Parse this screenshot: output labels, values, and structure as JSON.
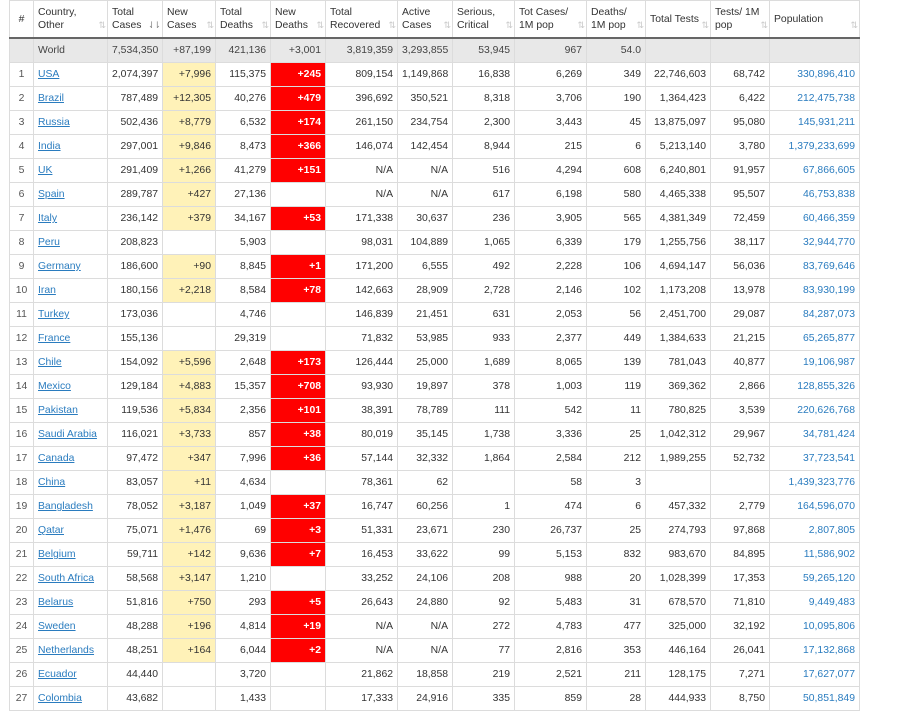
{
  "headers": [
    {
      "key": "idx",
      "label": "#",
      "sort": ""
    },
    {
      "key": "country",
      "label": "Country, Other",
      "sort": "⇅"
    },
    {
      "key": "total_cases",
      "label": "Total Cases",
      "sort": "⇃⇂",
      "active": true
    },
    {
      "key": "new_cases",
      "label": "New Cases",
      "sort": "⇅"
    },
    {
      "key": "total_deaths",
      "label": "Total Deaths",
      "sort": "⇅"
    },
    {
      "key": "new_deaths",
      "label": "New Deaths",
      "sort": "⇅"
    },
    {
      "key": "total_recovered",
      "label": "Total Recovered",
      "sort": "⇅"
    },
    {
      "key": "active_cases",
      "label": "Active Cases",
      "sort": "⇅"
    },
    {
      "key": "serious",
      "label": "Serious, Critical",
      "sort": "⇅"
    },
    {
      "key": "cases_per_m",
      "label": "Tot Cases/ 1M pop",
      "sort": "⇅"
    },
    {
      "key": "deaths_per_m",
      "label": "Deaths/ 1M pop",
      "sort": "⇅"
    },
    {
      "key": "total_tests",
      "label": "Total Tests",
      "sort": "⇅"
    },
    {
      "key": "tests_per_m",
      "label": "Tests/ 1M pop",
      "sort": "⇅"
    },
    {
      "key": "population",
      "label": "Population",
      "sort": "⇅"
    }
  ],
  "world": [
    "",
    "World",
    "7,534,350",
    "+87,199",
    "421,136",
    "+3,001",
    "3,819,359",
    "3,293,855",
    "53,945",
    "967",
    "54.0",
    "",
    "",
    ""
  ],
  "rows": [
    [
      "1",
      "USA",
      "2,074,397",
      "+7,996",
      "115,375",
      "+245",
      "809,154",
      "1,149,868",
      "16,838",
      "6,269",
      "349",
      "22,746,603",
      "68,742",
      "330,896,410"
    ],
    [
      "2",
      "Brazil",
      "787,489",
      "+12,305",
      "40,276",
      "+479",
      "396,692",
      "350,521",
      "8,318",
      "3,706",
      "190",
      "1,364,423",
      "6,422",
      "212,475,738"
    ],
    [
      "3",
      "Russia",
      "502,436",
      "+8,779",
      "6,532",
      "+174",
      "261,150",
      "234,754",
      "2,300",
      "3,443",
      "45",
      "13,875,097",
      "95,080",
      "145,931,211"
    ],
    [
      "4",
      "India",
      "297,001",
      "+9,846",
      "8,473",
      "+366",
      "146,074",
      "142,454",
      "8,944",
      "215",
      "6",
      "5,213,140",
      "3,780",
      "1,379,233,699"
    ],
    [
      "5",
      "UK",
      "291,409",
      "+1,266",
      "41,279",
      "+151",
      "N/A",
      "N/A",
      "516",
      "4,294",
      "608",
      "6,240,801",
      "91,957",
      "67,866,605"
    ],
    [
      "6",
      "Spain",
      "289,787",
      "+427",
      "27,136",
      "",
      "N/A",
      "N/A",
      "617",
      "6,198",
      "580",
      "4,465,338",
      "95,507",
      "46,753,838"
    ],
    [
      "7",
      "Italy",
      "236,142",
      "+379",
      "34,167",
      "+53",
      "171,338",
      "30,637",
      "236",
      "3,905",
      "565",
      "4,381,349",
      "72,459",
      "60,466,359"
    ],
    [
      "8",
      "Peru",
      "208,823",
      "",
      "5,903",
      "",
      "98,031",
      "104,889",
      "1,065",
      "6,339",
      "179",
      "1,255,756",
      "38,117",
      "32,944,770"
    ],
    [
      "9",
      "Germany",
      "186,600",
      "+90",
      "8,845",
      "+1",
      "171,200",
      "6,555",
      "492",
      "2,228",
      "106",
      "4,694,147",
      "56,036",
      "83,769,646"
    ],
    [
      "10",
      "Iran",
      "180,156",
      "+2,218",
      "8,584",
      "+78",
      "142,663",
      "28,909",
      "2,728",
      "2,146",
      "102",
      "1,173,208",
      "13,978",
      "83,930,199"
    ],
    [
      "11",
      "Turkey",
      "173,036",
      "",
      "4,746",
      "",
      "146,839",
      "21,451",
      "631",
      "2,053",
      "56",
      "2,451,700",
      "29,087",
      "84,287,073"
    ],
    [
      "12",
      "France",
      "155,136",
      "",
      "29,319",
      "",
      "71,832",
      "53,985",
      "933",
      "2,377",
      "449",
      "1,384,633",
      "21,215",
      "65,265,877"
    ],
    [
      "13",
      "Chile",
      "154,092",
      "+5,596",
      "2,648",
      "+173",
      "126,444",
      "25,000",
      "1,689",
      "8,065",
      "139",
      "781,043",
      "40,877",
      "19,106,987"
    ],
    [
      "14",
      "Mexico",
      "129,184",
      "+4,883",
      "15,357",
      "+708",
      "93,930",
      "19,897",
      "378",
      "1,003",
      "119",
      "369,362",
      "2,866",
      "128,855,326"
    ],
    [
      "15",
      "Pakistan",
      "119,536",
      "+5,834",
      "2,356",
      "+101",
      "38,391",
      "78,789",
      "111",
      "542",
      "11",
      "780,825",
      "3,539",
      "220,626,768"
    ],
    [
      "16",
      "Saudi Arabia",
      "116,021",
      "+3,733",
      "857",
      "+38",
      "80,019",
      "35,145",
      "1,738",
      "3,336",
      "25",
      "1,042,312",
      "29,967",
      "34,781,424"
    ],
    [
      "17",
      "Canada",
      "97,472",
      "+347",
      "7,996",
      "+36",
      "57,144",
      "32,332",
      "1,864",
      "2,584",
      "212",
      "1,989,255",
      "52,732",
      "37,723,541"
    ],
    [
      "18",
      "China",
      "83,057",
      "+11",
      "4,634",
      "",
      "78,361",
      "62",
      "",
      "58",
      "3",
      "",
      "",
      "1,439,323,776"
    ],
    [
      "19",
      "Bangladesh",
      "78,052",
      "+3,187",
      "1,049",
      "+37",
      "16,747",
      "60,256",
      "1",
      "474",
      "6",
      "457,332",
      "2,779",
      "164,596,070"
    ],
    [
      "20",
      "Qatar",
      "75,071",
      "+1,476",
      "69",
      "+3",
      "51,331",
      "23,671",
      "230",
      "26,737",
      "25",
      "274,793",
      "97,868",
      "2,807,805"
    ],
    [
      "21",
      "Belgium",
      "59,711",
      "+142",
      "9,636",
      "+7",
      "16,453",
      "33,622",
      "99",
      "5,153",
      "832",
      "983,670",
      "84,895",
      "11,586,902"
    ],
    [
      "22",
      "South Africa",
      "58,568",
      "+3,147",
      "1,210",
      "",
      "33,252",
      "24,106",
      "208",
      "988",
      "20",
      "1,028,399",
      "17,353",
      "59,265,120"
    ],
    [
      "23",
      "Belarus",
      "51,816",
      "+750",
      "293",
      "+5",
      "26,643",
      "24,880",
      "92",
      "5,483",
      "31",
      "678,570",
      "71,810",
      "9,449,483"
    ],
    [
      "24",
      "Sweden",
      "48,288",
      "+196",
      "4,814",
      "+19",
      "N/A",
      "N/A",
      "272",
      "4,783",
      "477",
      "325,000",
      "32,192",
      "10,095,806"
    ],
    [
      "25",
      "Netherlands",
      "48,251",
      "+164",
      "6,044",
      "+2",
      "N/A",
      "N/A",
      "77",
      "2,816",
      "353",
      "446,164",
      "26,041",
      "17,132,868"
    ],
    [
      "26",
      "Ecuador",
      "44,440",
      "",
      "3,720",
      "",
      "21,862",
      "18,858",
      "219",
      "2,521",
      "211",
      "128,175",
      "7,271",
      "17,627,077"
    ],
    [
      "27",
      "Colombia",
      "43,682",
      "",
      "1,433",
      "",
      "17,333",
      "24,916",
      "335",
      "859",
      "28",
      "444,933",
      "8,750",
      "50,851,849"
    ]
  ]
}
